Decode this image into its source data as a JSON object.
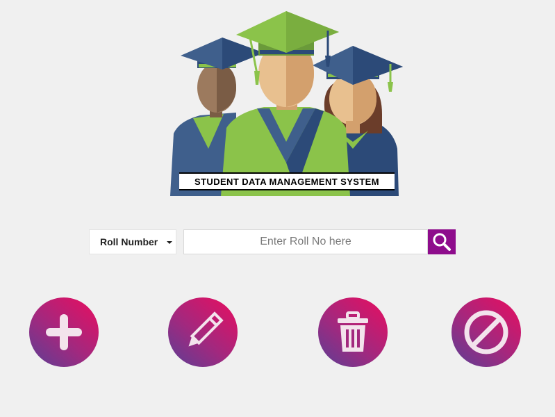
{
  "app": {
    "banner_title": "STUDENT DATA MANAGEMENT SYSTEM"
  },
  "search": {
    "field_select": {
      "selected": "Roll Number"
    },
    "input": {
      "placeholder": "Enter Roll No here",
      "value": ""
    },
    "button_icon": "search-icon"
  },
  "actions": [
    {
      "name": "add",
      "icon": "plus-icon"
    },
    {
      "name": "edit",
      "icon": "pencil-icon"
    },
    {
      "name": "delete",
      "icon": "trash-icon"
    },
    {
      "name": "cancel",
      "icon": "ban-icon"
    }
  ],
  "colors": {
    "background": "#f0f0f0",
    "search_button": "#8e0c8c",
    "gradient_start": "#5b3f95",
    "gradient_end": "#ea0d5f",
    "gown_green": "#8bc34a",
    "gown_blue": "#3f5f8c"
  }
}
